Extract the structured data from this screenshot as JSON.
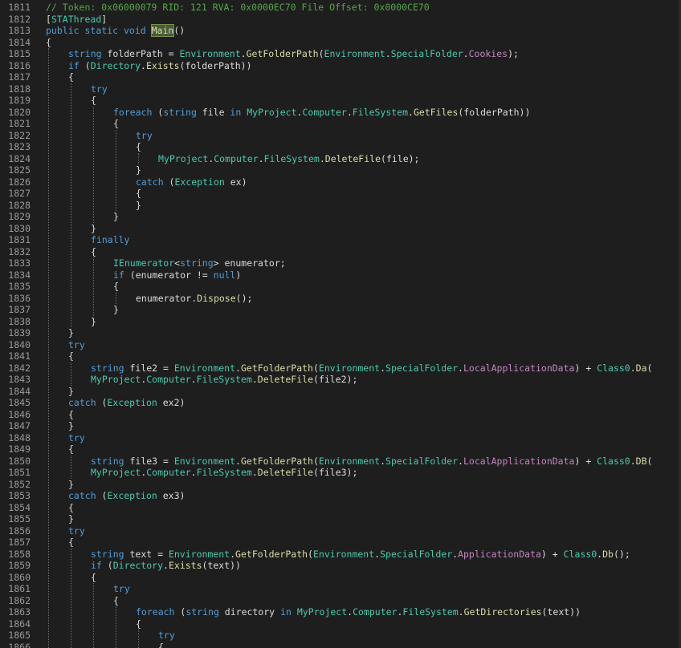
{
  "editor": {
    "lines": [
      {
        "n": "1811",
        "indent": 1,
        "tokens": [
          [
            "comment",
            "// Token: 0x06000079 RID: 121 RVA: 0x0000EC70 File Offset: 0x0000CE70"
          ]
        ]
      },
      {
        "n": "1812",
        "indent": 1,
        "tokens": [
          [
            "text",
            "["
          ],
          [
            "type",
            "STAThread"
          ],
          [
            "text",
            "]"
          ]
        ]
      },
      {
        "n": "1813",
        "indent": 1,
        "tokens": [
          [
            "keyword",
            "public"
          ],
          [
            "text",
            " "
          ],
          [
            "keyword",
            "static"
          ],
          [
            "text",
            " "
          ],
          [
            "keyword",
            "void"
          ],
          [
            "text",
            " "
          ],
          [
            "main",
            "Main"
          ],
          [
            "text",
            "()"
          ]
        ]
      },
      {
        "n": "1814",
        "indent": 1,
        "tokens": [
          [
            "text",
            "{"
          ]
        ]
      },
      {
        "n": "1815",
        "indent": 2,
        "tokens": [
          [
            "keyword",
            "string"
          ],
          [
            "text",
            " folderPath = "
          ],
          [
            "type",
            "Environment"
          ],
          [
            "text",
            "."
          ],
          [
            "method",
            "GetFolderPath"
          ],
          [
            "text",
            "("
          ],
          [
            "type",
            "Environment"
          ],
          [
            "text",
            "."
          ],
          [
            "type",
            "SpecialFolder"
          ],
          [
            "text",
            "."
          ],
          [
            "field",
            "Cookies"
          ],
          [
            "text",
            ");"
          ]
        ]
      },
      {
        "n": "1816",
        "indent": 2,
        "tokens": [
          [
            "keyword",
            "if"
          ],
          [
            "text",
            " ("
          ],
          [
            "type",
            "Directory"
          ],
          [
            "text",
            "."
          ],
          [
            "method",
            "Exists"
          ],
          [
            "text",
            "(folderPath))"
          ]
        ]
      },
      {
        "n": "1817",
        "indent": 2,
        "tokens": [
          [
            "text",
            "{"
          ]
        ]
      },
      {
        "n": "1818",
        "indent": 3,
        "tokens": [
          [
            "keyword",
            "try"
          ]
        ]
      },
      {
        "n": "1819",
        "indent": 3,
        "tokens": [
          [
            "text",
            "{"
          ]
        ]
      },
      {
        "n": "1820",
        "indent": 4,
        "tokens": [
          [
            "keyword",
            "foreach"
          ],
          [
            "text",
            " ("
          ],
          [
            "keyword",
            "string"
          ],
          [
            "text",
            " file "
          ],
          [
            "keyword",
            "in"
          ],
          [
            "text",
            " "
          ],
          [
            "ns",
            "MyProject"
          ],
          [
            "text",
            "."
          ],
          [
            "ns",
            "Computer"
          ],
          [
            "text",
            "."
          ],
          [
            "ns",
            "FileSystem"
          ],
          [
            "text",
            "."
          ],
          [
            "method",
            "GetFiles"
          ],
          [
            "text",
            "(folderPath))"
          ]
        ]
      },
      {
        "n": "1821",
        "indent": 4,
        "tokens": [
          [
            "text",
            "{"
          ]
        ]
      },
      {
        "n": "1822",
        "indent": 5,
        "tokens": [
          [
            "keyword",
            "try"
          ]
        ]
      },
      {
        "n": "1823",
        "indent": 5,
        "tokens": [
          [
            "text",
            "{"
          ]
        ]
      },
      {
        "n": "1824",
        "indent": 6,
        "tokens": [
          [
            "ns",
            "MyProject"
          ],
          [
            "text",
            "."
          ],
          [
            "ns",
            "Computer"
          ],
          [
            "text",
            "."
          ],
          [
            "ns",
            "FileSystem"
          ],
          [
            "text",
            "."
          ],
          [
            "method",
            "DeleteFile"
          ],
          [
            "text",
            "(file);"
          ]
        ]
      },
      {
        "n": "1825",
        "indent": 5,
        "tokens": [
          [
            "text",
            "}"
          ]
        ]
      },
      {
        "n": "1826",
        "indent": 5,
        "tokens": [
          [
            "keyword",
            "catch"
          ],
          [
            "text",
            " ("
          ],
          [
            "type",
            "Exception"
          ],
          [
            "text",
            " ex)"
          ]
        ]
      },
      {
        "n": "1827",
        "indent": 5,
        "tokens": [
          [
            "text",
            "{"
          ]
        ]
      },
      {
        "n": "1828",
        "indent": 5,
        "tokens": [
          [
            "text",
            "}"
          ]
        ]
      },
      {
        "n": "1829",
        "indent": 4,
        "tokens": [
          [
            "text",
            "}"
          ]
        ]
      },
      {
        "n": "1830",
        "indent": 3,
        "tokens": [
          [
            "text",
            "}"
          ]
        ]
      },
      {
        "n": "1831",
        "indent": 3,
        "tokens": [
          [
            "keyword",
            "finally"
          ]
        ]
      },
      {
        "n": "1832",
        "indent": 3,
        "tokens": [
          [
            "text",
            "{"
          ]
        ]
      },
      {
        "n": "1833",
        "indent": 4,
        "tokens": [
          [
            "type",
            "IEnumerator"
          ],
          [
            "text",
            "<"
          ],
          [
            "keyword",
            "string"
          ],
          [
            "text",
            "> enumerator;"
          ]
        ]
      },
      {
        "n": "1834",
        "indent": 4,
        "tokens": [
          [
            "keyword",
            "if"
          ],
          [
            "text",
            " (enumerator != "
          ],
          [
            "keyword",
            "null"
          ],
          [
            "text",
            ")"
          ]
        ]
      },
      {
        "n": "1835",
        "indent": 4,
        "tokens": [
          [
            "text",
            "{"
          ]
        ]
      },
      {
        "n": "1836",
        "indent": 5,
        "tokens": [
          [
            "text",
            "enumerator."
          ],
          [
            "method",
            "Dispose"
          ],
          [
            "text",
            "();"
          ]
        ]
      },
      {
        "n": "1837",
        "indent": 4,
        "tokens": [
          [
            "text",
            "}"
          ]
        ]
      },
      {
        "n": "1838",
        "indent": 3,
        "tokens": [
          [
            "text",
            "}"
          ]
        ]
      },
      {
        "n": "1839",
        "indent": 2,
        "tokens": [
          [
            "text",
            "}"
          ]
        ]
      },
      {
        "n": "1840",
        "indent": 2,
        "tokens": [
          [
            "keyword",
            "try"
          ]
        ]
      },
      {
        "n": "1841",
        "indent": 2,
        "tokens": [
          [
            "text",
            "{"
          ]
        ]
      },
      {
        "n": "1842",
        "indent": 3,
        "tokens": [
          [
            "keyword",
            "string"
          ],
          [
            "text",
            " file2 = "
          ],
          [
            "type",
            "Environment"
          ],
          [
            "text",
            "."
          ],
          [
            "method",
            "GetFolderPath"
          ],
          [
            "text",
            "("
          ],
          [
            "type",
            "Environment"
          ],
          [
            "text",
            "."
          ],
          [
            "type",
            "SpecialFolder"
          ],
          [
            "text",
            "."
          ],
          [
            "field",
            "LocalApplicationData"
          ],
          [
            "text",
            ") + "
          ],
          [
            "type",
            "Class0"
          ],
          [
            "text",
            "."
          ],
          [
            "method",
            "Da"
          ],
          [
            "text",
            "("
          ]
        ]
      },
      {
        "n": "1843",
        "indent": 3,
        "tokens": [
          [
            "ns",
            "MyProject"
          ],
          [
            "text",
            "."
          ],
          [
            "ns",
            "Computer"
          ],
          [
            "text",
            "."
          ],
          [
            "ns",
            "FileSystem"
          ],
          [
            "text",
            "."
          ],
          [
            "method",
            "DeleteFile"
          ],
          [
            "text",
            "(file2);"
          ]
        ]
      },
      {
        "n": "1844",
        "indent": 2,
        "tokens": [
          [
            "text",
            "}"
          ]
        ]
      },
      {
        "n": "1845",
        "indent": 2,
        "tokens": [
          [
            "keyword",
            "catch"
          ],
          [
            "text",
            " ("
          ],
          [
            "type",
            "Exception"
          ],
          [
            "text",
            " ex2)"
          ]
        ]
      },
      {
        "n": "1846",
        "indent": 2,
        "tokens": [
          [
            "text",
            "{"
          ]
        ]
      },
      {
        "n": "1847",
        "indent": 2,
        "tokens": [
          [
            "text",
            "}"
          ]
        ]
      },
      {
        "n": "1848",
        "indent": 2,
        "tokens": [
          [
            "keyword",
            "try"
          ]
        ]
      },
      {
        "n": "1849",
        "indent": 2,
        "tokens": [
          [
            "text",
            "{"
          ]
        ]
      },
      {
        "n": "1850",
        "indent": 3,
        "tokens": [
          [
            "keyword",
            "string"
          ],
          [
            "text",
            " file3 = "
          ],
          [
            "type",
            "Environment"
          ],
          [
            "text",
            "."
          ],
          [
            "method",
            "GetFolderPath"
          ],
          [
            "text",
            "("
          ],
          [
            "type",
            "Environment"
          ],
          [
            "text",
            "."
          ],
          [
            "type",
            "SpecialFolder"
          ],
          [
            "text",
            "."
          ],
          [
            "field",
            "LocalApplicationData"
          ],
          [
            "text",
            ") + "
          ],
          [
            "type",
            "Class0"
          ],
          [
            "text",
            "."
          ],
          [
            "method",
            "DB"
          ],
          [
            "text",
            "("
          ]
        ]
      },
      {
        "n": "1851",
        "indent": 3,
        "tokens": [
          [
            "ns",
            "MyProject"
          ],
          [
            "text",
            "."
          ],
          [
            "ns",
            "Computer"
          ],
          [
            "text",
            "."
          ],
          [
            "ns",
            "FileSystem"
          ],
          [
            "text",
            "."
          ],
          [
            "method",
            "DeleteFile"
          ],
          [
            "text",
            "(file3);"
          ]
        ]
      },
      {
        "n": "1852",
        "indent": 2,
        "tokens": [
          [
            "text",
            "}"
          ]
        ]
      },
      {
        "n": "1853",
        "indent": 2,
        "tokens": [
          [
            "keyword",
            "catch"
          ],
          [
            "text",
            " ("
          ],
          [
            "type",
            "Exception"
          ],
          [
            "text",
            " ex3)"
          ]
        ]
      },
      {
        "n": "1854",
        "indent": 2,
        "tokens": [
          [
            "text",
            "{"
          ]
        ]
      },
      {
        "n": "1855",
        "indent": 2,
        "tokens": [
          [
            "text",
            "}"
          ]
        ]
      },
      {
        "n": "1856",
        "indent": 2,
        "tokens": [
          [
            "keyword",
            "try"
          ]
        ]
      },
      {
        "n": "1857",
        "indent": 2,
        "tokens": [
          [
            "text",
            "{"
          ]
        ]
      },
      {
        "n": "1858",
        "indent": 3,
        "tokens": [
          [
            "keyword",
            "string"
          ],
          [
            "text",
            " text = "
          ],
          [
            "type",
            "Environment"
          ],
          [
            "text",
            "."
          ],
          [
            "method",
            "GetFolderPath"
          ],
          [
            "text",
            "("
          ],
          [
            "type",
            "Environment"
          ],
          [
            "text",
            "."
          ],
          [
            "type",
            "SpecialFolder"
          ],
          [
            "text",
            "."
          ],
          [
            "field",
            "ApplicationData"
          ],
          [
            "text",
            ") + "
          ],
          [
            "type",
            "Class0"
          ],
          [
            "text",
            "."
          ],
          [
            "method",
            "Db"
          ],
          [
            "text",
            "();"
          ]
        ]
      },
      {
        "n": "1859",
        "indent": 3,
        "tokens": [
          [
            "keyword",
            "if"
          ],
          [
            "text",
            " ("
          ],
          [
            "type",
            "Directory"
          ],
          [
            "text",
            "."
          ],
          [
            "method",
            "Exists"
          ],
          [
            "text",
            "(text))"
          ]
        ]
      },
      {
        "n": "1860",
        "indent": 3,
        "tokens": [
          [
            "text",
            "{"
          ]
        ]
      },
      {
        "n": "1861",
        "indent": 4,
        "tokens": [
          [
            "keyword",
            "try"
          ]
        ]
      },
      {
        "n": "1862",
        "indent": 4,
        "tokens": [
          [
            "text",
            "{"
          ]
        ]
      },
      {
        "n": "1863",
        "indent": 5,
        "tokens": [
          [
            "keyword",
            "foreach"
          ],
          [
            "text",
            " ("
          ],
          [
            "keyword",
            "string"
          ],
          [
            "text",
            " directory "
          ],
          [
            "keyword",
            "in"
          ],
          [
            "text",
            " "
          ],
          [
            "ns",
            "MyProject"
          ],
          [
            "text",
            "."
          ],
          [
            "ns",
            "Computer"
          ],
          [
            "text",
            "."
          ],
          [
            "ns",
            "FileSystem"
          ],
          [
            "text",
            "."
          ],
          [
            "method",
            "GetDirectories"
          ],
          [
            "text",
            "(text))"
          ]
        ]
      },
      {
        "n": "1864",
        "indent": 5,
        "tokens": [
          [
            "text",
            "{"
          ]
        ]
      },
      {
        "n": "1865",
        "indent": 6,
        "tokens": [
          [
            "keyword",
            "try"
          ]
        ]
      },
      {
        "n": "1866",
        "indent": 6,
        "tokens": [
          [
            "text",
            "{"
          ]
        ]
      }
    ]
  }
}
